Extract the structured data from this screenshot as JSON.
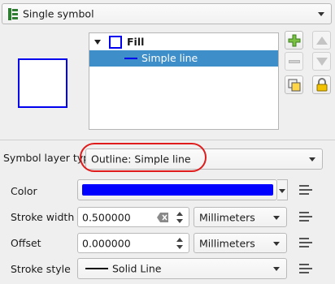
{
  "renderer": {
    "label": "Single symbol",
    "icon": "single-symbol-icon"
  },
  "symbol_tree": {
    "items": [
      {
        "label": "Fill",
        "icon": "fill-square-icon",
        "selected": false
      },
      {
        "label": "Simple line",
        "icon": "line-icon",
        "selected": true
      }
    ]
  },
  "layer_buttons": {
    "add": "add-layer-icon",
    "remove": "remove-layer-icon",
    "up": "move-up-icon",
    "down": "move-down-icon",
    "duplicate": "duplicate-layer-icon",
    "lock": "lock-icon"
  },
  "symbol_layer_type": {
    "label": "Symbol layer type",
    "value": "Outline: Simple line"
  },
  "properties": {
    "color": {
      "label": "Color",
      "value": "#0000ff"
    },
    "stroke_width": {
      "label": "Stroke width",
      "value": "0.500000",
      "unit": "Millimeters"
    },
    "offset": {
      "label": "Offset",
      "value": "0.000000",
      "unit": "Millimeters"
    },
    "stroke_style": {
      "label": "Stroke style",
      "value": "Solid Line"
    }
  },
  "colors": {
    "accent": "#3d8ec9",
    "highlight_ring": "#e01b1b",
    "stroke": "#0000ff"
  }
}
